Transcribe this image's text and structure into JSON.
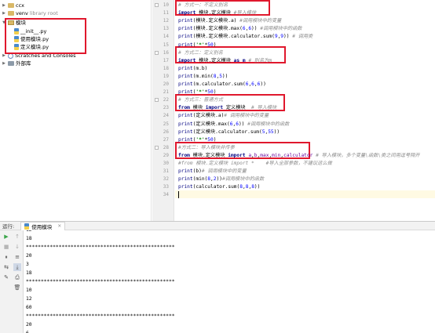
{
  "tree": {
    "items": [
      {
        "label": "ccx"
      },
      {
        "label": "venv",
        "hint": "library root"
      },
      {
        "label": "模块"
      },
      {
        "label": "__init__.py"
      },
      {
        "label": "使用模块.py"
      },
      {
        "label": "定义模块.py"
      },
      {
        "label": "Scratches and Consoles"
      },
      {
        "label": "外部库"
      }
    ]
  },
  "editor": {
    "line_numbers": [
      "10",
      "11",
      "12",
      "13",
      "14",
      "15",
      "16",
      "17",
      "18",
      "19",
      "20",
      "21",
      "22",
      "23",
      "24",
      "25",
      "26",
      "27",
      "28",
      "29",
      "30",
      "31",
      "32",
      "33",
      "34"
    ],
    "lines": [
      [
        {
          "t": "# 方式一：不定义别名",
          "c": "cm"
        }
      ],
      [
        {
          "t": "import",
          "c": "kw"
        },
        {
          "t": " 模块.定义模块 "
        },
        {
          "t": "#导入模块",
          "c": "cm"
        }
      ],
      [
        {
          "t": "print",
          "c": "bi"
        },
        {
          "t": "(模块.定义模块.a) "
        },
        {
          "t": "#调用模块中的变量",
          "c": "cm"
        }
      ],
      [
        {
          "t": "print",
          "c": "bi"
        },
        {
          "t": "(模块.定义模块.max("
        },
        {
          "t": "6",
          "c": "num"
        },
        {
          "t": ","
        },
        {
          "t": "6",
          "c": "num"
        },
        {
          "t": ")) "
        },
        {
          "t": "#调用模块中的函数",
          "c": "cm"
        }
      ],
      [
        {
          "t": "print",
          "c": "bi"
        },
        {
          "t": "(模块.定义模块.calculator.sum("
        },
        {
          "t": "9",
          "c": "num"
        },
        {
          "t": ","
        },
        {
          "t": "9",
          "c": "num"
        },
        {
          "t": ")) "
        },
        {
          "t": "# 调用类",
          "c": "cm"
        }
      ],
      [
        {
          "t": "print",
          "c": "bi"
        },
        {
          "t": "("
        },
        {
          "t": "'*'",
          "c": "str"
        },
        {
          "t": "*"
        },
        {
          "t": "50",
          "c": "num"
        },
        {
          "t": ")"
        }
      ],
      [
        {
          "t": "# 方式二：定义别名",
          "c": "cm"
        }
      ],
      [
        {
          "t": "import",
          "c": "kw"
        },
        {
          "t": " 模块.定义模块 "
        },
        {
          "t": "as",
          "c": "kw"
        },
        {
          "t": " "
        },
        {
          "t": "m",
          "c": "kw"
        },
        {
          "t": " "
        },
        {
          "t": "# 别名为m",
          "c": "cm"
        }
      ],
      [
        {
          "t": "print",
          "c": "bi"
        },
        {
          "t": "(m.b)"
        }
      ],
      [
        {
          "t": "print",
          "c": "bi"
        },
        {
          "t": "(m.min("
        },
        {
          "t": "8",
          "c": "num"
        },
        {
          "t": ","
        },
        {
          "t": "5",
          "c": "num"
        },
        {
          "t": "))"
        }
      ],
      [
        {
          "t": "print",
          "c": "bi"
        },
        {
          "t": "(m.calculator.sum("
        },
        {
          "t": "6",
          "c": "num"
        },
        {
          "t": ","
        },
        {
          "t": "6",
          "c": "num"
        },
        {
          "t": ","
        },
        {
          "t": "6",
          "c": "num"
        },
        {
          "t": "))"
        }
      ],
      [
        {
          "t": "print",
          "c": "bi"
        },
        {
          "t": "("
        },
        {
          "t": "'*'",
          "c": "str"
        },
        {
          "t": "*"
        },
        {
          "t": "50",
          "c": "num"
        },
        {
          "t": ")"
        }
      ],
      [
        {
          "t": "# 方式三：普通方式",
          "c": "cm"
        }
      ],
      [
        {
          "t": "from",
          "c": "kw"
        },
        {
          "t": " 模块 "
        },
        {
          "t": "import",
          "c": "kw"
        },
        {
          "t": " 定义模块  "
        },
        {
          "t": "# 导入模块",
          "c": "cm"
        }
      ],
      [
        {
          "t": "print",
          "c": "bi"
        },
        {
          "t": "(定义模块.a)"
        },
        {
          "t": "# 调用模块中的变量",
          "c": "cm"
        }
      ],
      [
        {
          "t": "print",
          "c": "bi"
        },
        {
          "t": "(定义模块.max("
        },
        {
          "t": "6",
          "c": "num"
        },
        {
          "t": ","
        },
        {
          "t": "6",
          "c": "num"
        },
        {
          "t": ")) "
        },
        {
          "t": "#调用模块中的函数",
          "c": "cm"
        }
      ],
      [
        {
          "t": "print",
          "c": "bi"
        },
        {
          "t": "(定义模块.calculator.sum("
        },
        {
          "t": "5",
          "c": "num"
        },
        {
          "t": ","
        },
        {
          "t": "55",
          "c": "num"
        },
        {
          "t": "))"
        }
      ],
      [
        {
          "t": "print",
          "c": "bi"
        },
        {
          "t": "("
        },
        {
          "t": "'*'",
          "c": "str"
        },
        {
          "t": "*"
        },
        {
          "t": "50",
          "c": "num"
        },
        {
          "t": ")"
        }
      ],
      [
        {
          "t": "#方式二：导入模块并传参",
          "c": "cm"
        }
      ],
      [
        {
          "t": "from",
          "c": "kw"
        },
        {
          "t": " 模块.定义模块 "
        },
        {
          "t": "import",
          "c": "kw"
        },
        {
          "t": " "
        },
        {
          "t": "a",
          "c": "pm"
        },
        {
          "t": ","
        },
        {
          "t": "b",
          "c": "pm"
        },
        {
          "t": ","
        },
        {
          "t": "max",
          "c": "pm"
        },
        {
          "t": ","
        },
        {
          "t": "min",
          "c": "pm"
        },
        {
          "t": ","
        },
        {
          "t": "calculator",
          "c": "pm"
        },
        {
          "t": " "
        },
        {
          "t": "# 导入模块，多个变量\\函数\\类之间用逗号隔开",
          "c": "cm"
        }
      ],
      [
        {
          "t": "#from 模块.定义模块 import *    #导入全部参数，不建议这么做",
          "c": "cm"
        }
      ],
      [
        {
          "t": "print",
          "c": "bi"
        },
        {
          "t": "(b)"
        },
        {
          "t": "# 调用模块中的变量",
          "c": "cm"
        }
      ],
      [
        {
          "t": "print",
          "c": "bi"
        },
        {
          "t": "(min("
        },
        {
          "t": "8",
          "c": "num"
        },
        {
          "t": ","
        },
        {
          "t": "2",
          "c": "num"
        },
        {
          "t": "))"
        },
        {
          "t": "#调用模块中的函数",
          "c": "cm"
        }
      ],
      [
        {
          "t": "print",
          "c": "bi"
        },
        {
          "t": "(calculator.sum("
        },
        {
          "t": "8",
          "c": "num"
        },
        {
          "t": ","
        },
        {
          "t": "8",
          "c": "num"
        },
        {
          "t": ","
        },
        {
          "t": "8",
          "c": "num"
        },
        {
          "t": "))"
        }
      ],
      []
    ]
  },
  "run": {
    "label": "运行:",
    "tab_label": "使用模块",
    "close_symbol": "×",
    "output": [
      "12",
      "18",
      "**************************************************",
      "20",
      "3",
      "18",
      "**************************************************",
      "10",
      "12",
      "60",
      "**************************************************",
      "20",
      "6",
      "24"
    ]
  },
  "colors": {
    "annotation_box": "#e0182d",
    "keyword": "#000080",
    "comment": "#8c8c8c",
    "number": "#0000ff",
    "string": "#008000"
  }
}
